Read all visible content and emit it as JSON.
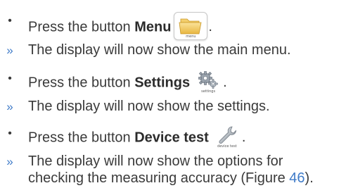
{
  "steps": [
    {
      "kind": "action",
      "marker": "•",
      "prefix": "Press the button ",
      "button_name": "Menu",
      "icon": "folder-icon",
      "icon_caption": "menu",
      "suffix": "."
    },
    {
      "kind": "result",
      "marker": "»",
      "text": "The display will now show the main menu."
    },
    {
      "kind": "action",
      "marker": "•",
      "prefix": "Press the button ",
      "button_name": "Settings",
      "icon": "gears-icon",
      "icon_caption": "settings",
      "suffix": "."
    },
    {
      "kind": "result",
      "marker": "»",
      "text": "The display will now show the settings."
    },
    {
      "kind": "action",
      "marker": "•",
      "prefix": "Press the button ",
      "button_name": "Device test",
      "icon": "wrench-icon",
      "icon_caption": "device test",
      "suffix": "."
    },
    {
      "kind": "result",
      "marker": "»",
      "line1": "The display will now show the options for",
      "line2_before": "checking the measuring accuracy (Figure ",
      "line2_link": "46",
      "line2_after": ")."
    }
  ],
  "colors": {
    "text": "#3a3a3a",
    "accent": "#3f7bc8"
  }
}
